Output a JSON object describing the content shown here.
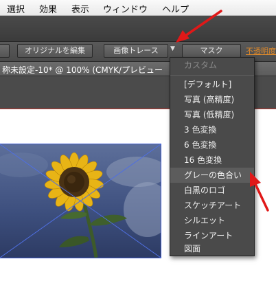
{
  "menubar": {
    "items": [
      "選択",
      "効果",
      "表示",
      "ウィンドウ",
      "ヘルプ"
    ]
  },
  "controlbar": {
    "edit_original_label": "オリジナルを編集",
    "image_trace_label": "画像トレース",
    "dropdown_arrow": "▼",
    "mask_label": "マスク",
    "opacity_label": "不透明度"
  },
  "document": {
    "tab_title": "称未設定-10* @ 100% (CMYK/プレビュー"
  },
  "trace_menu": {
    "header": "カスタム",
    "items": [
      "[デフォルト]",
      "写真 (高精度)",
      "写真 (低精度)",
      "3 色変換",
      "6 色変換",
      "16 色変換",
      "グレーの色合い",
      "白黒のロゴ",
      "スケッチアート",
      "シルエット",
      "ラインアート",
      "図面"
    ],
    "highlighted_index": 6
  },
  "colors": {
    "annotation_arrow": "#e01818",
    "selection_outline": "#3e5bd0",
    "accent_link": "#e08a2a"
  }
}
